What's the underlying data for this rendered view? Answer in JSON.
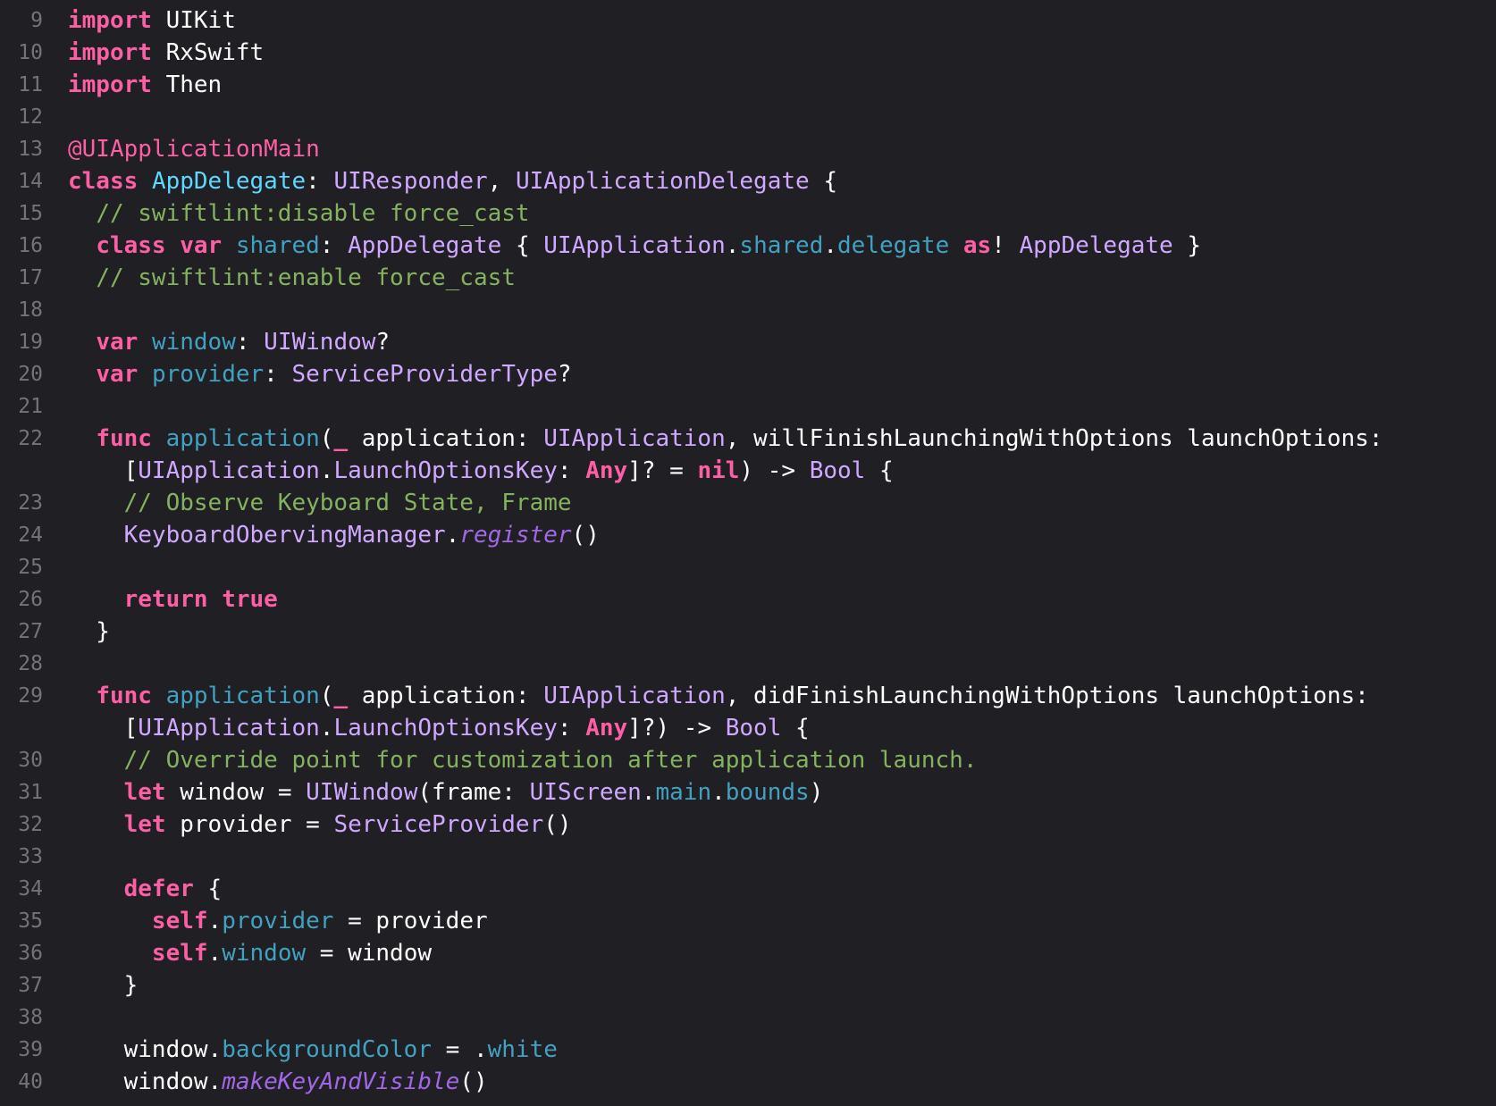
{
  "editor": {
    "language": "Swift",
    "theme_colors": {
      "background": "#1f1f24",
      "keyword": "#fc5fa3",
      "type": "#d0a8ff",
      "declaration": "#5dd8ff",
      "property": "#41a1c0",
      "comment": "#84b360",
      "function_call": "#a167e6",
      "plain": "#ffffff",
      "line_number": "#747478"
    },
    "lines": [
      {
        "n": "9",
        "tokens": [
          [
            "kw",
            "import"
          ],
          [
            "p",
            " UIKit"
          ]
        ]
      },
      {
        "n": "10",
        "tokens": [
          [
            "kw",
            "import"
          ],
          [
            "p",
            " RxSwift"
          ]
        ]
      },
      {
        "n": "11",
        "tokens": [
          [
            "kw",
            "import"
          ],
          [
            "p",
            " Then"
          ]
        ]
      },
      {
        "n": "12",
        "tokens": []
      },
      {
        "n": "13",
        "tokens": [
          [
            "attrpink",
            "@UIApplicationMain"
          ]
        ]
      },
      {
        "n": "14",
        "tokens": [
          [
            "kw",
            "class"
          ],
          [
            "p",
            " "
          ],
          [
            "decl",
            "AppDelegate"
          ],
          [
            "p",
            ": "
          ],
          [
            "ty",
            "UIResponder"
          ],
          [
            "p",
            ", "
          ],
          [
            "ty",
            "UIApplicationDelegate"
          ],
          [
            "p",
            " {"
          ]
        ]
      },
      {
        "n": "15",
        "tokens": [
          [
            "p",
            "  "
          ],
          [
            "cm2",
            "// swiftlint:disable force_cast"
          ]
        ]
      },
      {
        "n": "16",
        "tokens": [
          [
            "p",
            "  "
          ],
          [
            "kw",
            "class"
          ],
          [
            "p",
            " "
          ],
          [
            "kw",
            "var"
          ],
          [
            "p",
            " "
          ],
          [
            "prop",
            "shared"
          ],
          [
            "p",
            ": "
          ],
          [
            "ty",
            "AppDelegate"
          ],
          [
            "p",
            " { "
          ],
          [
            "ty",
            "UIApplication"
          ],
          [
            "p",
            "."
          ],
          [
            "prop",
            "shared"
          ],
          [
            "p",
            "."
          ],
          [
            "prop",
            "delegate"
          ],
          [
            "p",
            " "
          ],
          [
            "kw",
            "as"
          ],
          [
            "p",
            "! "
          ],
          [
            "ty",
            "AppDelegate"
          ],
          [
            "p",
            " }"
          ]
        ]
      },
      {
        "n": "17",
        "tokens": [
          [
            "p",
            "  "
          ],
          [
            "cm2",
            "// swiftlint:enable force_cast"
          ]
        ]
      },
      {
        "n": "18",
        "tokens": []
      },
      {
        "n": "19",
        "tokens": [
          [
            "p",
            "  "
          ],
          [
            "kw",
            "var"
          ],
          [
            "p",
            " "
          ],
          [
            "prop",
            "window"
          ],
          [
            "p",
            ": "
          ],
          [
            "ty",
            "UIWindow"
          ],
          [
            "p",
            "?"
          ]
        ]
      },
      {
        "n": "20",
        "tokens": [
          [
            "p",
            "  "
          ],
          [
            "kw",
            "var"
          ],
          [
            "p",
            " "
          ],
          [
            "prop",
            "provider"
          ],
          [
            "p",
            ": "
          ],
          [
            "ty",
            "ServiceProviderType"
          ],
          [
            "p",
            "?"
          ]
        ]
      },
      {
        "n": "21",
        "tokens": []
      },
      {
        "n": "22",
        "tokens": [
          [
            "p",
            "  "
          ],
          [
            "kw",
            "func"
          ],
          [
            "p",
            " "
          ],
          [
            "prop",
            "application"
          ],
          [
            "p",
            "("
          ],
          [
            "kw",
            "_"
          ],
          [
            "p",
            " application: "
          ],
          [
            "ty",
            "UIApplication"
          ],
          [
            "p",
            ", willFinishLaunchingWithOptions launchOptions:"
          ]
        ]
      },
      {
        "n": "",
        "tokens": [
          [
            "p",
            "    ["
          ],
          [
            "ty",
            "UIApplication"
          ],
          [
            "p",
            "."
          ],
          [
            "ty",
            "LaunchOptionsKey"
          ],
          [
            "p",
            ": "
          ],
          [
            "nil",
            "Any"
          ],
          [
            "p",
            "]? = "
          ],
          [
            "nil",
            "nil"
          ],
          [
            "p",
            ") -> "
          ],
          [
            "ty",
            "Bool"
          ],
          [
            "p",
            " {"
          ]
        ]
      },
      {
        "n": "23",
        "tokens": [
          [
            "p",
            "    "
          ],
          [
            "cm2",
            "// Observe Keyboard State, Frame"
          ]
        ]
      },
      {
        "n": "24",
        "tokens": [
          [
            "p",
            "    "
          ],
          [
            "ty",
            "KeyboardObervingManager"
          ],
          [
            "p",
            "."
          ],
          [
            "fn",
            "register"
          ],
          [
            "p",
            "()"
          ]
        ]
      },
      {
        "n": "25",
        "tokens": []
      },
      {
        "n": "26",
        "tokens": [
          [
            "p",
            "    "
          ],
          [
            "kw",
            "return"
          ],
          [
            "p",
            " "
          ],
          [
            "kw",
            "true"
          ]
        ]
      },
      {
        "n": "27",
        "tokens": [
          [
            "p",
            "  }"
          ]
        ]
      },
      {
        "n": "28",
        "tokens": []
      },
      {
        "n": "29",
        "tokens": [
          [
            "p",
            "  "
          ],
          [
            "kw",
            "func"
          ],
          [
            "p",
            " "
          ],
          [
            "prop",
            "application"
          ],
          [
            "p",
            "("
          ],
          [
            "kw",
            "_"
          ],
          [
            "p",
            " application: "
          ],
          [
            "ty",
            "UIApplication"
          ],
          [
            "p",
            ", didFinishLaunchingWithOptions launchOptions:"
          ]
        ]
      },
      {
        "n": "",
        "tokens": [
          [
            "p",
            "    ["
          ],
          [
            "ty",
            "UIApplication"
          ],
          [
            "p",
            "."
          ],
          [
            "ty",
            "LaunchOptionsKey"
          ],
          [
            "p",
            ": "
          ],
          [
            "nil",
            "Any"
          ],
          [
            "p",
            "]?) -> "
          ],
          [
            "ty",
            "Bool"
          ],
          [
            "p",
            " {"
          ]
        ]
      },
      {
        "n": "30",
        "tokens": [
          [
            "p",
            "    "
          ],
          [
            "cm2",
            "// Override point for customization after application launch."
          ]
        ]
      },
      {
        "n": "31",
        "tokens": [
          [
            "p",
            "    "
          ],
          [
            "kw",
            "let"
          ],
          [
            "p",
            " window = "
          ],
          [
            "ty",
            "UIWindow"
          ],
          [
            "p",
            "(frame: "
          ],
          [
            "ty",
            "UIScreen"
          ],
          [
            "p",
            "."
          ],
          [
            "prop",
            "main"
          ],
          [
            "p",
            "."
          ],
          [
            "prop",
            "bounds"
          ],
          [
            "p",
            ")"
          ]
        ]
      },
      {
        "n": "32",
        "tokens": [
          [
            "p",
            "    "
          ],
          [
            "kw",
            "let"
          ],
          [
            "p",
            " provider = "
          ],
          [
            "ty",
            "ServiceProvider"
          ],
          [
            "p",
            "()"
          ]
        ]
      },
      {
        "n": "33",
        "tokens": []
      },
      {
        "n": "34",
        "tokens": [
          [
            "p",
            "    "
          ],
          [
            "kw",
            "defer"
          ],
          [
            "p",
            " {"
          ]
        ]
      },
      {
        "n": "35",
        "tokens": [
          [
            "p",
            "      "
          ],
          [
            "kw",
            "self"
          ],
          [
            "p",
            "."
          ],
          [
            "prop",
            "provider"
          ],
          [
            "p",
            " = provider"
          ]
        ]
      },
      {
        "n": "36",
        "tokens": [
          [
            "p",
            "      "
          ],
          [
            "kw",
            "self"
          ],
          [
            "p",
            "."
          ],
          [
            "prop",
            "window"
          ],
          [
            "p",
            " = window"
          ]
        ]
      },
      {
        "n": "37",
        "tokens": [
          [
            "p",
            "    }"
          ]
        ]
      },
      {
        "n": "38",
        "tokens": []
      },
      {
        "n": "39",
        "tokens": [
          [
            "p",
            "    window."
          ],
          [
            "prop",
            "backgroundColor"
          ],
          [
            "p",
            " = ."
          ],
          [
            "prop",
            "white"
          ]
        ]
      },
      {
        "n": "40",
        "tokens": [
          [
            "p",
            "    window."
          ],
          [
            "fn",
            "makeKeyAndVisible"
          ],
          [
            "p",
            "()"
          ]
        ]
      }
    ]
  }
}
